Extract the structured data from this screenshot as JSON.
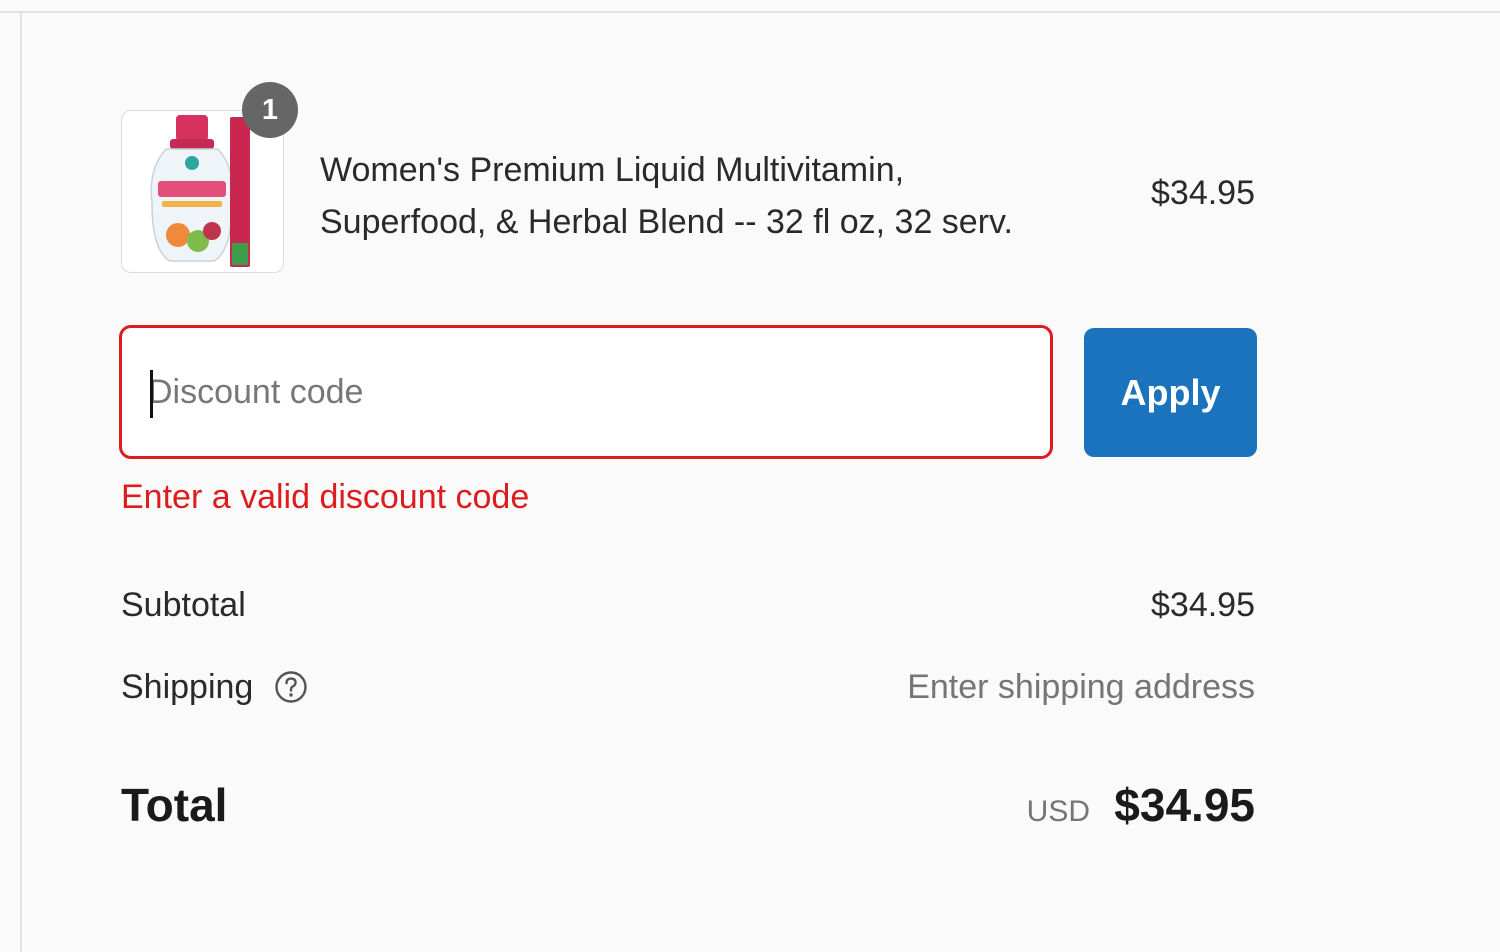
{
  "line_item": {
    "quantity": "1",
    "name_line1": "Women's Premium Liquid Multivitamin,",
    "name_line2": "Superfood, & Herbal Blend -- 32 fl oz, 32 serv.",
    "price": "$34.95",
    "image_icon": "product-bottle-icon"
  },
  "discount": {
    "placeholder": "Discount code",
    "value": "",
    "apply_label": "Apply",
    "error": "Enter a valid discount code"
  },
  "summary": {
    "subtotal_label": "Subtotal",
    "subtotal_value": "$34.95",
    "shipping_label": "Shipping",
    "shipping_icon": "help-circle-icon",
    "shipping_value": "Enter shipping address",
    "total_label": "Total",
    "total_currency": "USD",
    "total_value": "$34.95"
  },
  "colors": {
    "accent": "#1c73bd",
    "error": "#dd1d1d",
    "background": "#fafafa"
  }
}
